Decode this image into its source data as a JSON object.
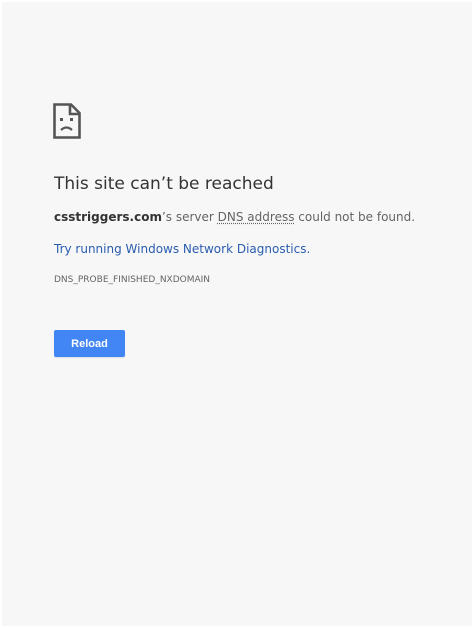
{
  "error_page": {
    "icon": "sad-page-icon",
    "title": "This site can’t be reached",
    "message": {
      "host": "csstriggers.com",
      "text_before_dns": "’s server ",
      "dns_term": "DNS address",
      "text_after_dns": " could not be found."
    },
    "diagnostics_link": "Try running Windows Network Diagnostics.",
    "error_code": "DNS_PROBE_FINISHED_NXDOMAIN",
    "reload_label": "Reload"
  },
  "colors": {
    "background": "#f7f7f7",
    "button": "#4285f4",
    "link": "#2a5db0"
  }
}
